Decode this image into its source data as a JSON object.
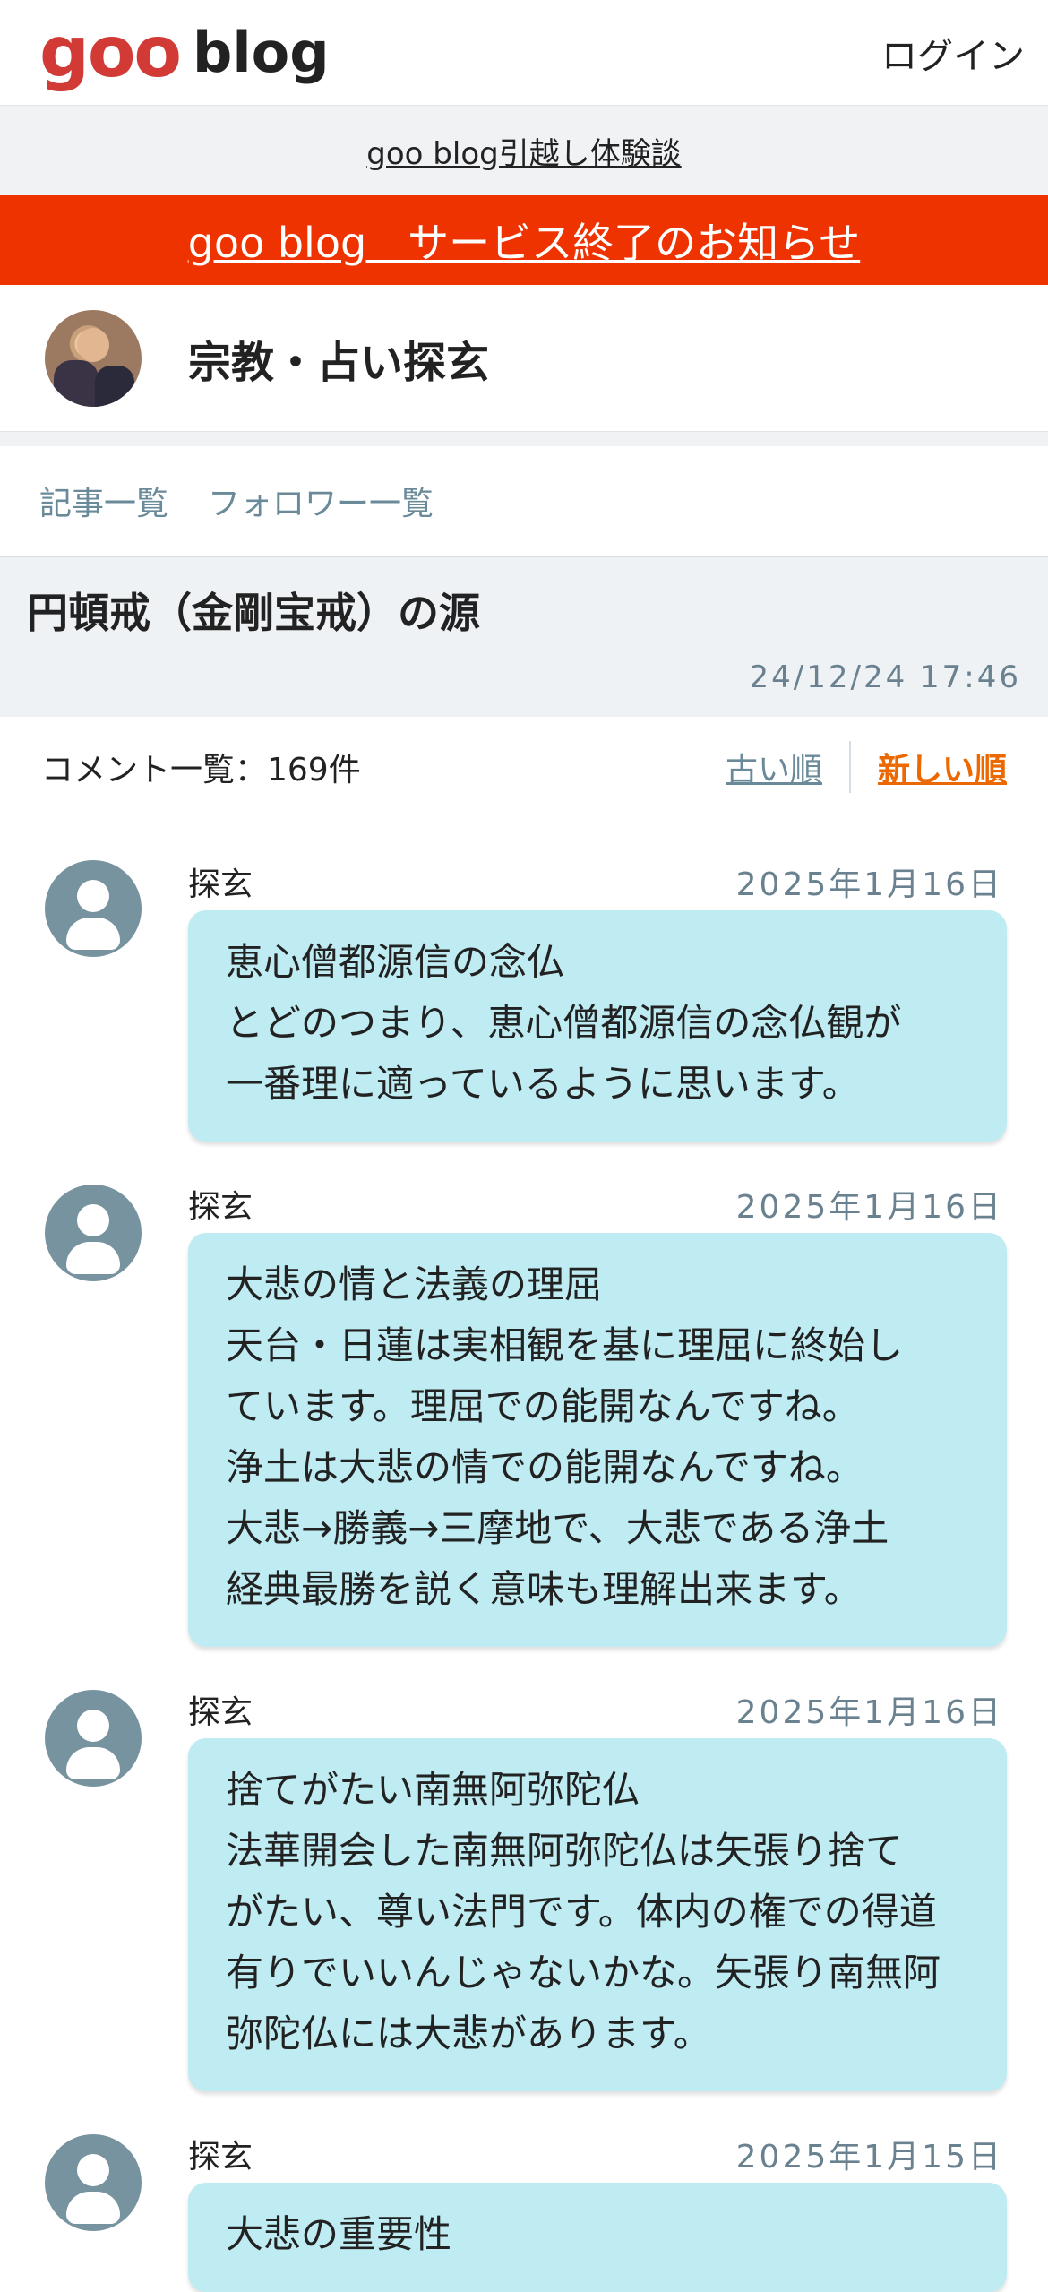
{
  "header": {
    "logo_goo": "goo",
    "logo_blog": "blog",
    "login_label": "ログイン"
  },
  "notice": {
    "label": "goo blog引越し体験談"
  },
  "end_banner": {
    "label": "goo blog　サービス終了のお知らせ"
  },
  "blog": {
    "name": "宗教・占い探玄"
  },
  "tabs": [
    {
      "label": "記事一覧"
    },
    {
      "label": "フォロワー一覧"
    }
  ],
  "article": {
    "title": "円頓戒（金剛宝戒）の源",
    "date": "24/12/24 17:46"
  },
  "comment_bar": {
    "count_label": "コメント一覧：169件",
    "sort_old": "古い順",
    "sort_new": "新しい順"
  },
  "comments": [
    {
      "author": "探玄",
      "date": "2025年1月16日",
      "lines": [
        "恵心僧都源信の念仏",
        "とどのつまり、恵心僧都源信の念仏観が",
        "一番理に適っているように思います。"
      ]
    },
    {
      "author": "探玄",
      "date": "2025年1月16日",
      "lines": [
        "大悲の情と法義の理屈",
        "天台・日蓮は実相観を基に理屈に終始し",
        "ています。理屈での能開なんですね。",
        "浄土は大悲の情での能開なんですね。",
        "大悲→勝義→三摩地で、大悲である浄土",
        "経典最勝を説く意味も理解出来ます。"
      ]
    },
    {
      "author": "探玄",
      "date": "2025年1月16日",
      "lines": [
        "捨てがたい南無阿弥陀仏",
        "法華開会した南無阿弥陀仏は矢張り捨て",
        "がたい、尊い法門です。体内の権での得道",
        "有りでいいんじゃないかな。矢張り南無阿",
        "弥陀仏には大悲があります。"
      ]
    },
    {
      "author": "探玄",
      "date": "2025年1月15日",
      "lines": [
        "大悲の重要性"
      ]
    }
  ]
}
